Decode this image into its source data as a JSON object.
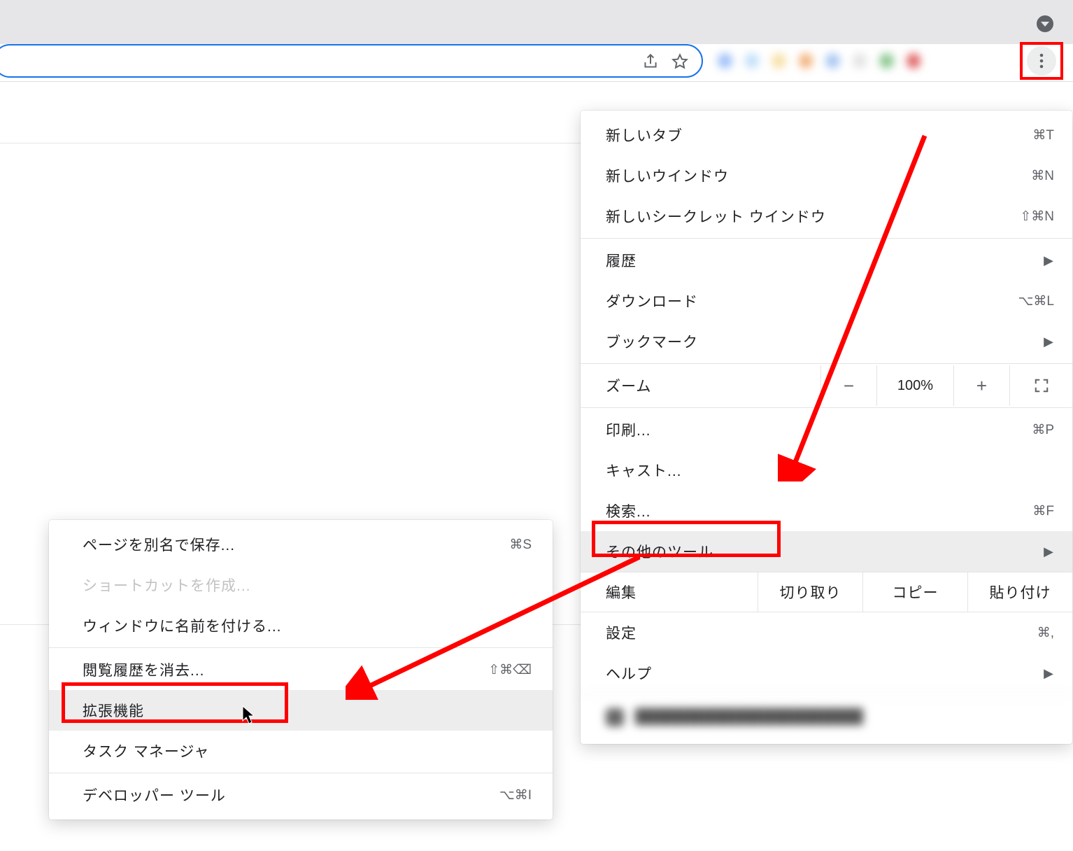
{
  "menu": {
    "new_tab": {
      "label": "新しいタブ",
      "shortcut": "⌘T"
    },
    "new_window": {
      "label": "新しいウインドウ",
      "shortcut": "⌘N"
    },
    "new_incognito": {
      "label": "新しいシークレット ウインドウ",
      "shortcut": "⇧⌘N"
    },
    "history": {
      "label": "履歴"
    },
    "downloads": {
      "label": "ダウンロード",
      "shortcut": "⌥⌘L"
    },
    "bookmarks": {
      "label": "ブックマーク"
    },
    "zoom": {
      "label": "ズーム",
      "value": "100%"
    },
    "print": {
      "label": "印刷...",
      "shortcut": "⌘P"
    },
    "cast": {
      "label": "キャスト..."
    },
    "find": {
      "label": "検索...",
      "shortcut": "⌘F"
    },
    "more_tools": {
      "label": "その他のツール"
    },
    "edit": {
      "label": "編集",
      "cut": "切り取り",
      "copy": "コピー",
      "paste": "貼り付け"
    },
    "settings": {
      "label": "設定",
      "shortcut": "⌘,"
    },
    "help": {
      "label": "ヘルプ"
    }
  },
  "submenu": {
    "save_as": {
      "label": "ページを別名で保存...",
      "shortcut": "⌘S"
    },
    "create_shortcut": {
      "label": "ショートカットを作成..."
    },
    "name_window": {
      "label": "ウィンドウに名前を付ける..."
    },
    "clear_browsing": {
      "label": "閲覧履歴を消去...",
      "shortcut": "⇧⌘⌫"
    },
    "extensions": {
      "label": "拡張機能"
    },
    "task_manager": {
      "label": "タスク マネージャ"
    },
    "dev_tools": {
      "label": "デベロッパー ツール",
      "shortcut": "⌥⌘I"
    }
  },
  "extension_colors": [
    "#9ec1f7",
    "#c1dff8",
    "#f7e1a8",
    "#f2b37e",
    "#a8c7f2",
    "#e3e3e3",
    "#8dc891",
    "#e06666",
    "#c8c8c8"
  ]
}
